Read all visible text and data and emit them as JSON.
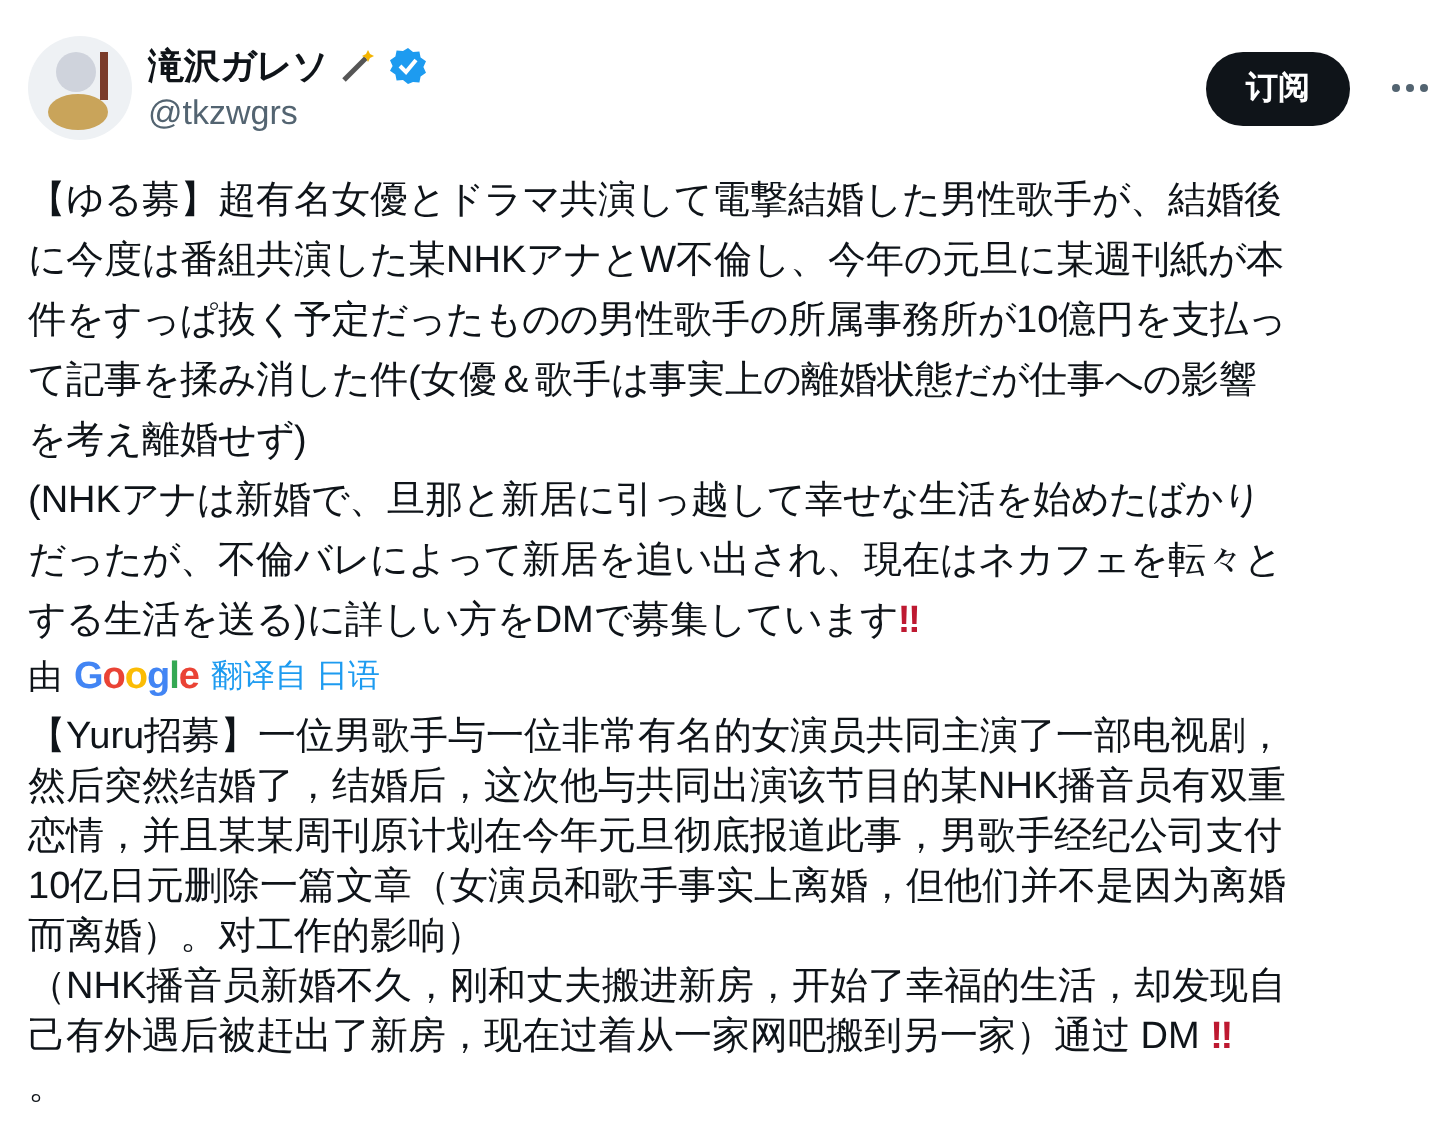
{
  "author": {
    "name": "滝沢ガレソ",
    "handle": "@tkzwgrs",
    "verified": true
  },
  "subscribe_button": "订阅",
  "original_text": {
    "lines": [
      "【ゆる募】超有名女優とドラマ共演して電撃結婚した男性歌手が、結婚後",
      "に今度は番組共演した某NHKアナとW不倫し、今年の元旦に某週刊紙が本",
      "件をすっぱ抜く予定だったものの男性歌手の所属事務所が10億円を支払っ",
      "て記事を揉み消した件(女優＆歌手は事実上の離婚状態だが仕事への影響",
      "を考え離婚せず)",
      "(NHKアナは新婚で、旦那と新居に引っ越して幸せな生活を始めたばかり",
      "だったが、不倫バレによって新居を追い出され、現在はネカフェを転々と",
      "する生活を送る)に詳しい方をDMで募集しています"
    ],
    "emoji": "‼"
  },
  "translation_note": {
    "prefix": "由",
    "brand": "Google",
    "link": "翻译自 日语"
  },
  "translated_text": {
    "lines": [
      "【Yuru招募】一位男歌手与一位非常有名的女演员共同主演了一部电视剧，",
      "然后突然结婚了，结婚后，这次他与共同出演该节目的某NHK播音员有双重",
      "恋情，并且某某周刊原计划在今年元旦彻底报道此事，男歌手经纪公司支付",
      "10亿日元删除一篇文章（女演员和歌手事实上离婚，但他们并不是因为离婚",
      "而离婚）。对工作的影响）",
      "（NHK播音员新婚不久，刚和丈夫搬进新房，开始了幸福的生活，却发现自",
      "己有外遇后被赶出了新房，现在过着从一家网吧搬到另一家）通过 DM "
    ],
    "emoji": "‼",
    "tail": "。"
  }
}
